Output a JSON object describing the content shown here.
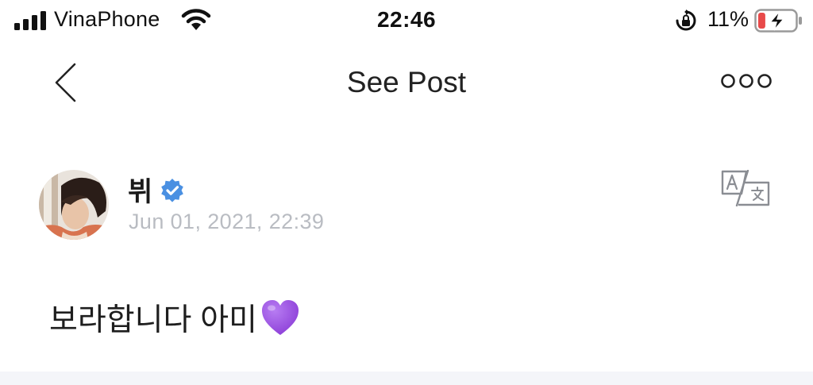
{
  "status_bar": {
    "carrier": "VinaPhone",
    "time": "22:46",
    "battery_percent": "11%",
    "battery_level": 0.11,
    "signal_icon": "signal-bars-icon",
    "wifi_icon": "wifi-icon",
    "rotation_icon": "rotation-lock-icon",
    "battery_icon": "battery-charging-icon"
  },
  "nav": {
    "title": "See Post",
    "back_icon": "chevron-left-icon",
    "more_icon": "more-options-icon"
  },
  "post": {
    "author": "뷔",
    "verified_icon": "verified-badge-icon",
    "timestamp": "Jun 01, 2021, 22:39",
    "translate_icon": "translate-icon",
    "text": "보라합니다 아미",
    "emoji_icon": "purple-heart-icon"
  },
  "colors": {
    "verified": "#4a90e2",
    "timestamp": "#b9bcc2",
    "heart": "#9b4fe0",
    "battery_low": "#e84a4a",
    "bottom_strip": "#f4f5f9"
  }
}
